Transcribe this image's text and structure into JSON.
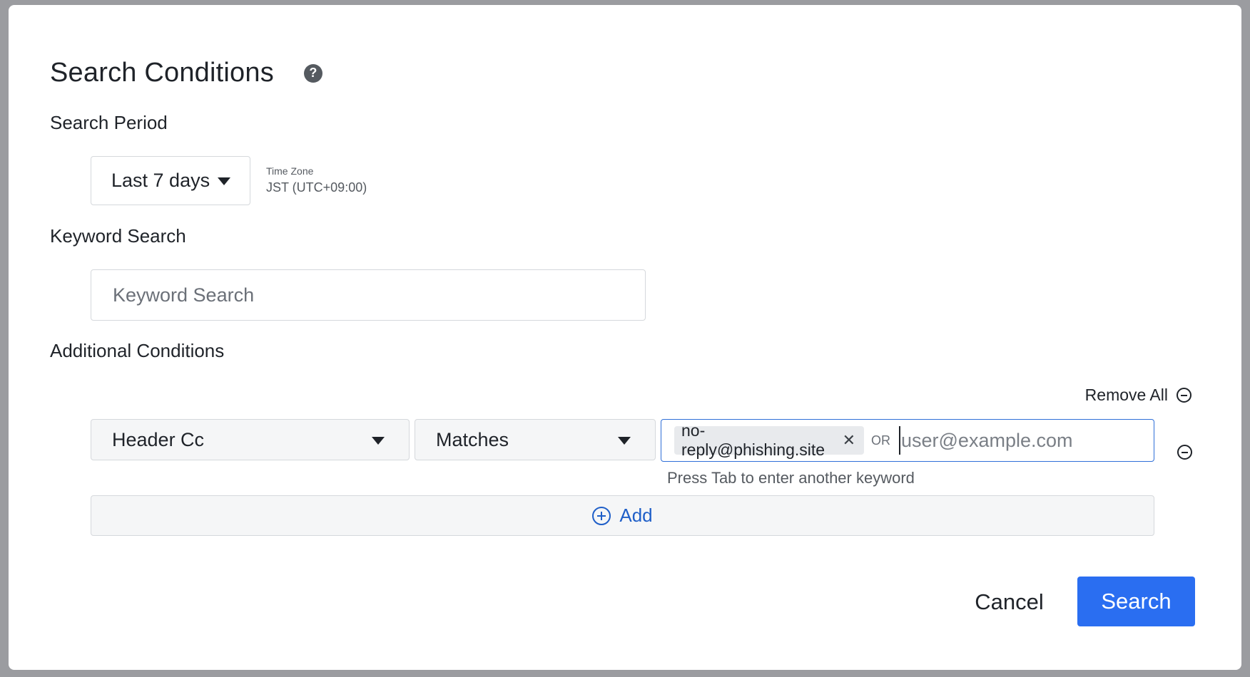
{
  "dialog": {
    "title": "Search Conditions",
    "help_icon": "question-circle-icon"
  },
  "search_period": {
    "label": "Search Period",
    "selected": "Last 7 days",
    "timezone_label": "Time Zone",
    "timezone_value": "JST (UTC+09:00)"
  },
  "keyword_search": {
    "label": "Keyword Search",
    "placeholder": "Keyword Search",
    "value": ""
  },
  "additional_conditions": {
    "label": "Additional Conditions",
    "remove_all_label": "Remove All",
    "conditions": [
      {
        "field": "Header Cc",
        "operator": "Matches",
        "tags": [
          "no-reply@phishing.site"
        ],
        "or_label": "OR",
        "input_placeholder": "user@example.com",
        "hint": "Press Tab to enter another keyword"
      }
    ],
    "add_label": "Add"
  },
  "footer": {
    "cancel_label": "Cancel",
    "search_label": "Search"
  },
  "colors": {
    "primary": "#2a6ef1",
    "link": "#1f5fc8",
    "focus_border": "#2f6fd8",
    "backdrop": "#9b9ca0"
  }
}
